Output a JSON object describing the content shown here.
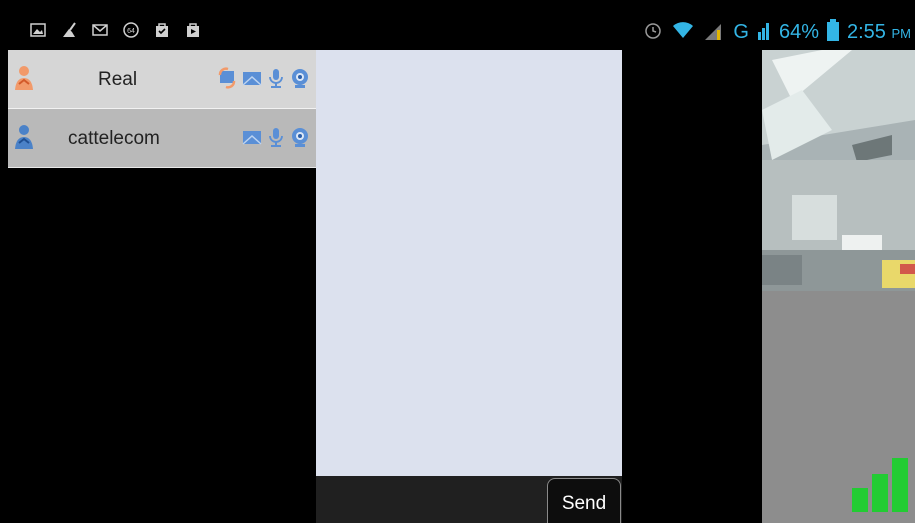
{
  "status_bar": {
    "battery_percent": "64%",
    "time": "2:55",
    "time_suffix": "PM",
    "network_type": "G",
    "left_icons": [
      "gallery-icon",
      "cleaner-icon",
      "gmail-icon",
      "badge-64-icon",
      "shopping-bag-check-icon",
      "shopping-bag-icon"
    ],
    "right_icons": [
      "alarm-icon",
      "wifi-icon",
      "signal-icon",
      "battery-icon"
    ]
  },
  "contacts": [
    {
      "name": "Real",
      "icons": [
        "transfer-icon",
        "message-icon",
        "microphone-icon",
        "webcam-icon"
      ]
    },
    {
      "name": "cattelecom",
      "icons": [
        "message-icon",
        "microphone-icon",
        "webcam-icon"
      ]
    }
  ],
  "composer": {
    "send_label": "Send"
  },
  "call": {
    "signal_strength_level": 3,
    "signal_strength_max": 3
  },
  "colors": {
    "accent": "#33b5e5",
    "chat_bg": "#dce1ee",
    "signal_green": "#22cc33"
  }
}
